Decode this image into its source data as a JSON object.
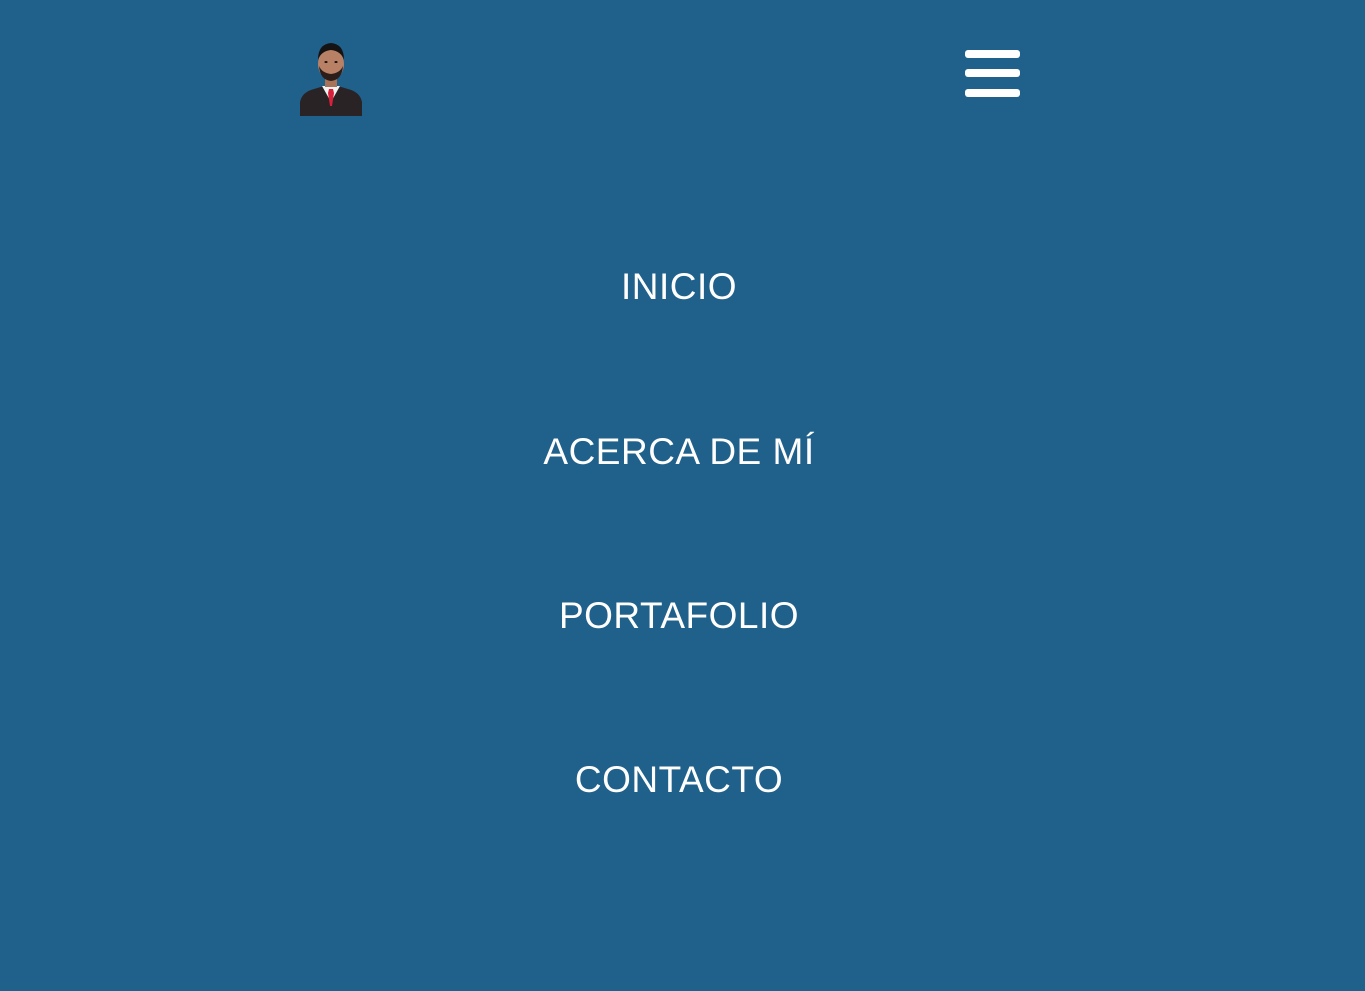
{
  "colors": {
    "background": "#20618c",
    "text": "#ffffff"
  },
  "header": {
    "avatar_icon": "profile-photo",
    "menu_icon": "hamburger-icon"
  },
  "nav": {
    "items": [
      {
        "label": "INICIO"
      },
      {
        "label": "ACERCA DE MÍ"
      },
      {
        "label": "PORTAFOLIO"
      },
      {
        "label": "CONTACTO"
      }
    ]
  }
}
